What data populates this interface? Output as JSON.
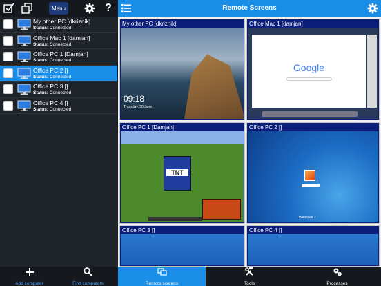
{
  "sidebar": {
    "toolbar": {
      "menu_label": "Menu",
      "help_label": "?"
    },
    "status_prefix": "Status:",
    "computers": [
      {
        "name": "My other PC [dkriznik]",
        "status": "Connected",
        "selected": false
      },
      {
        "name": "Office Mac 1 [damjan]",
        "status": "Connected",
        "selected": false
      },
      {
        "name": "Office PC 1 [Damjan]",
        "status": "Connected",
        "selected": false
      },
      {
        "name": "Office PC 2 []",
        "status": "Connected",
        "selected": true
      },
      {
        "name": "Office PC 3 []",
        "status": "Connected",
        "selected": false
      },
      {
        "name": "Office PC 4 []",
        "status": "Connected",
        "selected": false
      }
    ],
    "bottom": {
      "add_label": "Add computer",
      "find_label": "Find computers"
    }
  },
  "main": {
    "title": "Remote Screens",
    "tiles": [
      {
        "title": "My other PC [dkriznik]",
        "clock": "09:18",
        "date": "Thursday, 30 June"
      },
      {
        "title": "Office Mac 1 [damjan]",
        "logo": "Google"
      },
      {
        "title": "Office PC 1 [Damjan]",
        "tnt": "TNT"
      },
      {
        "title": "Office PC 2 []",
        "brand": "Windows 7"
      },
      {
        "title": "Office PC 3 []"
      },
      {
        "title": "Office PC 4 []"
      }
    ],
    "tabs": [
      {
        "label": "Remote screens",
        "active": true
      },
      {
        "label": "Tools",
        "active": false
      },
      {
        "label": "Processes",
        "active": false
      }
    ]
  },
  "colors": {
    "accent": "#1a8de6",
    "tile_header": "#0b1e7a",
    "link": "#4aa3ff"
  }
}
